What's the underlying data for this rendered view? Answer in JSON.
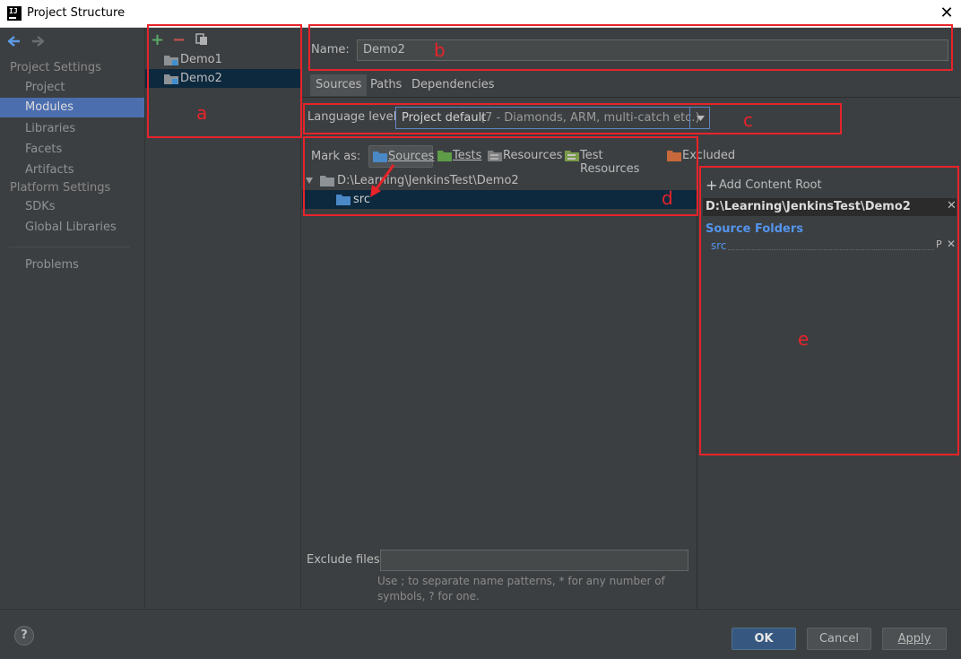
{
  "window": {
    "title": "Project Structure",
    "app_icon_text": "IJ"
  },
  "nav": {
    "back_icon": "arrow-left-icon",
    "forward_icon": "arrow-right-icon",
    "sections": [
      {
        "label": "Project Settings",
        "items": [
          "Project",
          "Modules",
          "Libraries",
          "Facets",
          "Artifacts"
        ]
      },
      {
        "label": "Platform Settings",
        "items": [
          "SDKs",
          "Global Libraries"
        ]
      }
    ],
    "problems": "Problems",
    "selected": "Modules"
  },
  "modules": {
    "toolbar": {
      "add": "+",
      "remove": "−",
      "copy_icon": "copy-icon"
    },
    "items": [
      "Demo1",
      "Demo2"
    ],
    "selected": "Demo2"
  },
  "name": {
    "label": "Name:",
    "value": "Demo2"
  },
  "tabs": [
    "Sources",
    "Paths",
    "Dependencies"
  ],
  "active_tab": "Sources",
  "language": {
    "label": "Language level:",
    "value": "Project default",
    "detail": "(7 - Diamonds, ARM, multi-catch etc.)"
  },
  "mark_as": {
    "label": "Mark as:",
    "buttons": [
      {
        "label": "Sources",
        "color": "#4a88c7"
      },
      {
        "label": "Tests",
        "color": "#5e9c48"
      },
      {
        "label": "Resources",
        "color": "#7f7f7f"
      },
      {
        "label": "Test Resources",
        "color": "#7a9a4a"
      },
      {
        "label": "Excluded",
        "color": "#c7693a"
      }
    ]
  },
  "tree": {
    "root": "D:\\Learning\\JenkinsTest\\Demo2",
    "child": "src"
  },
  "content_root": {
    "add_label": "Add Content Root",
    "path": "D:\\Learning\\JenkinsTest\\Demo2",
    "source_folders_label": "Source Folders",
    "folder": "src",
    "folder_suffix": "P"
  },
  "exclude": {
    "label": "Exclude files:",
    "value": "",
    "hint_line1": "Use ; to separate name patterns, * for any number of",
    "hint_line2": "symbols, ? for one."
  },
  "buttons": {
    "ok": "OK",
    "cancel": "Cancel",
    "apply": "Apply",
    "help": "?"
  },
  "annotations": [
    "a",
    "b",
    "c",
    "d",
    "e"
  ],
  "colors": {
    "annotation": "#e8232a",
    "selection": "#4b6eaf",
    "link": "#5394ec"
  }
}
